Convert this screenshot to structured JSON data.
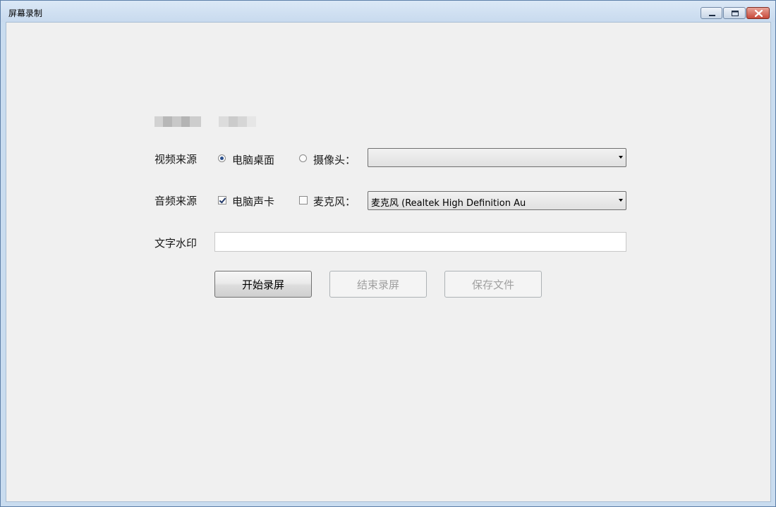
{
  "window": {
    "title": "屏幕录制",
    "controls": {
      "minimize": "minimize-icon",
      "maximize": "maximize-icon",
      "close": "close-icon"
    }
  },
  "form": {
    "video_source": {
      "label": "视频来源",
      "options": [
        {
          "label": "电脑桌面",
          "selected": true
        },
        {
          "label": "摄像头：",
          "selected": false
        }
      ],
      "camera_select": {
        "value": ""
      }
    },
    "audio_source": {
      "label": "音频来源",
      "options": [
        {
          "label": "电脑声卡",
          "checked": true
        },
        {
          "label": "麦克风：",
          "checked": false
        }
      ],
      "mic_select": {
        "value": "麦克风 (Realtek High Definition Au"
      }
    },
    "watermark": {
      "label": "文字水印",
      "value": ""
    }
  },
  "buttons": {
    "start": {
      "label": "开始录屏",
      "enabled": true
    },
    "stop": {
      "label": "结束录屏",
      "enabled": false
    },
    "save": {
      "label": "保存文件",
      "enabled": false
    }
  }
}
